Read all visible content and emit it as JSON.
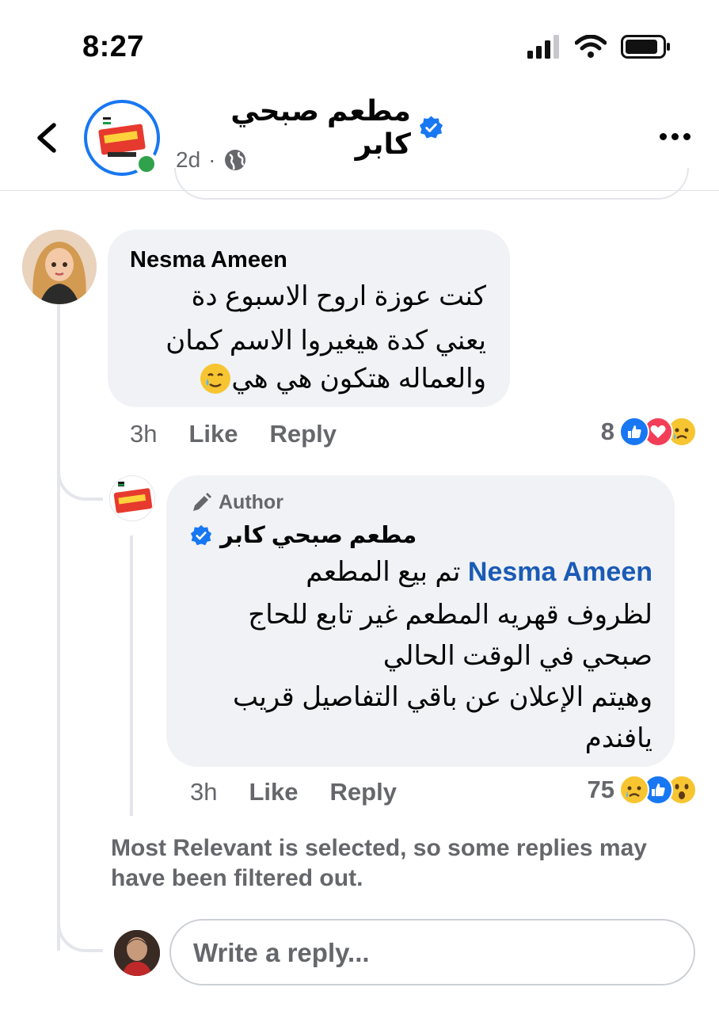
{
  "status_bar": {
    "time": "8:27"
  },
  "post_header": {
    "page_name": "مطعم صبحي كابر",
    "age": "2d",
    "separator": "·"
  },
  "comment": {
    "author": "Nesma Ameen",
    "lines": [
      "كنت عوزة اروح الاسبوع دة",
      "يعني كدة هيغيروا الاسم كمان",
      "والعماله هتكون هي هي"
    ],
    "time_ago": "3h",
    "like_label": "Like",
    "reply_label": "Reply",
    "reaction_count": "8",
    "reaction_icons": [
      "like-reaction",
      "love-reaction",
      "sad-reaction"
    ]
  },
  "reply": {
    "badge": "Author",
    "author": "مطعم صبحي كابر",
    "mention": "Nesma Ameen",
    "line1_rest": "تم بيع المطعم",
    "lines": [
      "لظروف قهريه المطعم غير تابع للحاج",
      "صبحي في الوقت الحالي",
      "وهيتم الإعلان عن باقي التفاصيل قريب",
      "يافندم"
    ],
    "time_ago": "3h",
    "like_label": "Like",
    "reply_label": "Reply",
    "reaction_count": "75",
    "reaction_icons": [
      "sad-reaction",
      "like-reaction",
      "wow-reaction"
    ]
  },
  "filter_note": "Most Relevant is selected, so some replies may have been filtered out.",
  "composer": {
    "placeholder": "Write a reply..."
  },
  "colors": {
    "facebook_blue": "#1877f2",
    "mention": "#1a5bb5",
    "bubble": "#f0f2f5",
    "secondary_text": "#65676b",
    "online": "#31a24c"
  }
}
